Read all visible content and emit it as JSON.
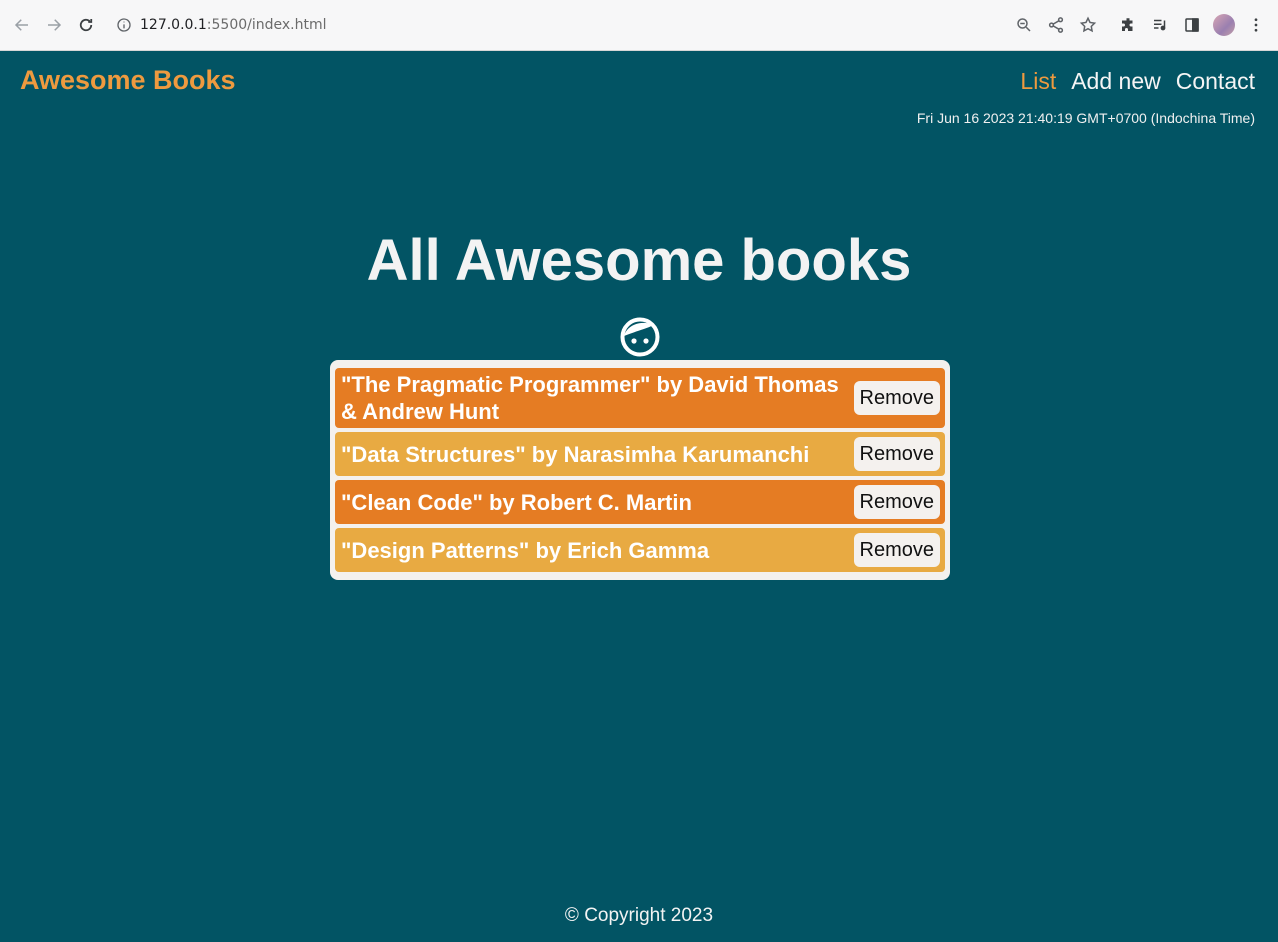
{
  "browser": {
    "url_host": "127.0.0.1",
    "url_path": ":5500/index.html"
  },
  "header": {
    "brand": "Awesome Books",
    "nav": [
      {
        "label": "List",
        "active": true
      },
      {
        "label": "Add new",
        "active": false
      },
      {
        "label": "Contact",
        "active": false
      }
    ],
    "datetime": "Fri Jun 16 2023 21:40:19 GMT+0700 (Indochina Time)"
  },
  "main": {
    "heading": "All Awesome books",
    "books": [
      {
        "title": "\"The Pragmatic Programmer\" by David Thomas & Andrew Hunt",
        "remove_label": "Remove"
      },
      {
        "title": "\"Data Structures\" by Narasimha Karumanchi",
        "remove_label": "Remove"
      },
      {
        "title": "\"Clean Code\" by Robert C. Martin",
        "remove_label": "Remove"
      },
      {
        "title": "\"Design Patterns\" by Erich Gamma",
        "remove_label": "Remove"
      }
    ]
  },
  "footer": {
    "copyright": "© Copyright 2023"
  },
  "colors": {
    "background": "#025464",
    "accent": "#ee9a3f",
    "row_odd": "#e57c23",
    "row_even": "#e8aa42"
  }
}
